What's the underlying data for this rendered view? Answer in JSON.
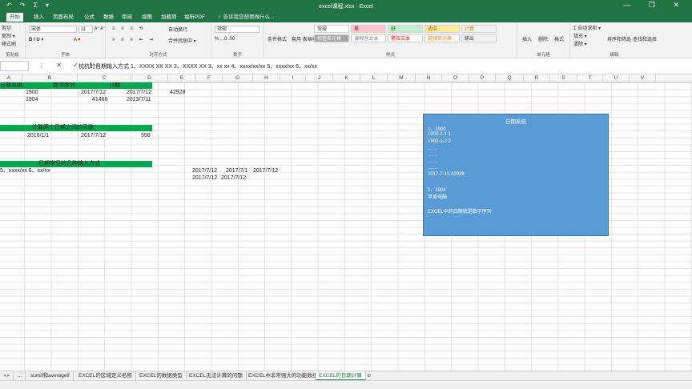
{
  "window": {
    "title": "excel课程.xlsx - Excel",
    "qat_icons": "↶ ↷ Σ ▾",
    "controls": "—  ❐  ✕"
  },
  "ribbon_tabs": [
    "开始",
    "插入",
    "页面布局",
    "公式",
    "数据",
    "审阅",
    "视图",
    "加载项",
    "福昕PDF",
    "♀ 告诉我您想要做什么..."
  ],
  "clipboard": {
    "cut": "剪切",
    "copy": "复制 ▾",
    "painter": "格式刷",
    "label": "剪贴板"
  },
  "font": {
    "name": "宋体",
    "size": "11",
    "grow": "A⁺ A⁻",
    "formats": "B  I  U  ▾",
    "label": "字体"
  },
  "alignment": {
    "wrap": "自动换行",
    "merge": "合并后居中 ▾",
    "label": "对齐方式"
  },
  "number": {
    "format": "常规",
    "symbols": "% ,  .0 .00",
    "label": "数字"
  },
  "styles": {
    "conditional": "条件格式",
    "table": "套用\n表格格式",
    "normal": "常规",
    "bad": "差",
    "good": "好",
    "neutral": "适中",
    "calc": "计算",
    "check": "检查单元格",
    "explain": "解释性文本",
    "warn": "警告文本",
    "link": "链接单元格",
    "output": "输出",
    "label": "样式"
  },
  "cells_group": {
    "insert": "插入",
    "delete": "删除",
    "format": "格式",
    "label": "单元格"
  },
  "editing": {
    "autosum": "Σ 自动求和 ▾",
    "fill": "填充 ▾",
    "clear": "清除 ▾",
    "sort": "排序和筛选",
    "find": "查找和选择",
    "label": "编辑"
  },
  "formula_bar": {
    "name_box": "",
    "icons": "⋮ ✕ ✓ fx",
    "content": "杭杭的日期输入方式 1、XXXX XX XX 2、XXXX XX 3、xx xx 4、xxxx/xx/xx 5、xxxx/xx 6、xx/xx"
  },
  "columns": [
    "A",
    "B",
    "C",
    "D",
    "E",
    "F",
    "G",
    "H",
    "I",
    "J",
    "K",
    "L",
    "M",
    "N",
    "O",
    "P",
    "Q",
    "R",
    "S",
    "T",
    "U",
    "V"
  ],
  "cells": {
    "a1": "日期系统",
    "b1": "数字序列",
    "c1": "日期",
    "a2": "1900",
    "b2": "2017/7/12",
    "c2": "2017/7/12",
    "d2": "42928",
    "a3": "1904",
    "b3": "41466",
    "c3": "2013/7/11",
    "b7": "计算两个日期之间的天数",
    "a8": "2016/1/1",
    "b8": "2017/7/12",
    "c8": "558",
    "b12": "日期常见的几种输入方式",
    "a13": "5、xxxx/xx 6、xx/xx",
    "e13": "2017/7/12",
    "f13": "2017/7/1",
    "g13": "2017/7/12",
    "e14": "2017/7/12",
    "f14": "2017/7/12"
  },
  "shape": {
    "title": "日期系统",
    "lines": [
      "1、1900",
      "1900-1-1    1",
      "1900-1-2    2",
      "……",
      "……",
      "……",
      "……",
      "2017-7-12  42928",
      "",
      "2、1904",
      "苹果电脑",
      "",
      "EXCEL中的日期就是数字序列"
    ]
  },
  "sheet_tabs": [
    "...",
    "sumif和averageif",
    "EXCEL的区域定义名称",
    "EXCEL的数据类型",
    "EXCEL无法计算的问题",
    "EXCEL中非常强大的功能数组",
    "EXCEL的日期计算"
  ],
  "accent_color": "#217346",
  "highlight_color": "#00a650",
  "shape_color": "#5b9bd5"
}
